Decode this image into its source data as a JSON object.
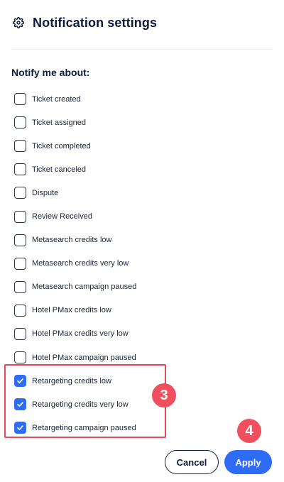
{
  "header": {
    "title": "Notification settings",
    "icon": "gear-icon"
  },
  "section": {
    "label": "Notify me about:"
  },
  "options": [
    {
      "label": "Ticket created",
      "checked": false
    },
    {
      "label": "Ticket assigned",
      "checked": false
    },
    {
      "label": "Ticket completed",
      "checked": false
    },
    {
      "label": "Ticket canceled",
      "checked": false
    },
    {
      "label": "Dispute",
      "checked": false
    },
    {
      "label": "Review Received",
      "checked": false
    },
    {
      "label": "Metasearch credits low",
      "checked": false
    },
    {
      "label": "Metasearch credits very low",
      "checked": false
    },
    {
      "label": "Metasearch campaign paused",
      "checked": false
    },
    {
      "label": "Hotel PMax credits low",
      "checked": false
    },
    {
      "label": "Hotel PMax credits very low",
      "checked": false
    },
    {
      "label": "Hotel PMax campaign paused",
      "checked": false
    },
    {
      "label": "Retargeting credits low",
      "checked": true
    },
    {
      "label": "Retargeting credits very low",
      "checked": true
    },
    {
      "label": "Retargeting campaign paused",
      "checked": true
    }
  ],
  "annotations": {
    "step_3": "3",
    "step_4": "4",
    "highlight_color": "#e5495b",
    "badge_color": "#f0505e"
  },
  "actions": {
    "cancel_label": "Cancel",
    "apply_label": "Apply"
  },
  "colors": {
    "accent": "#2f6cf6",
    "text": "#0d1b3d"
  }
}
